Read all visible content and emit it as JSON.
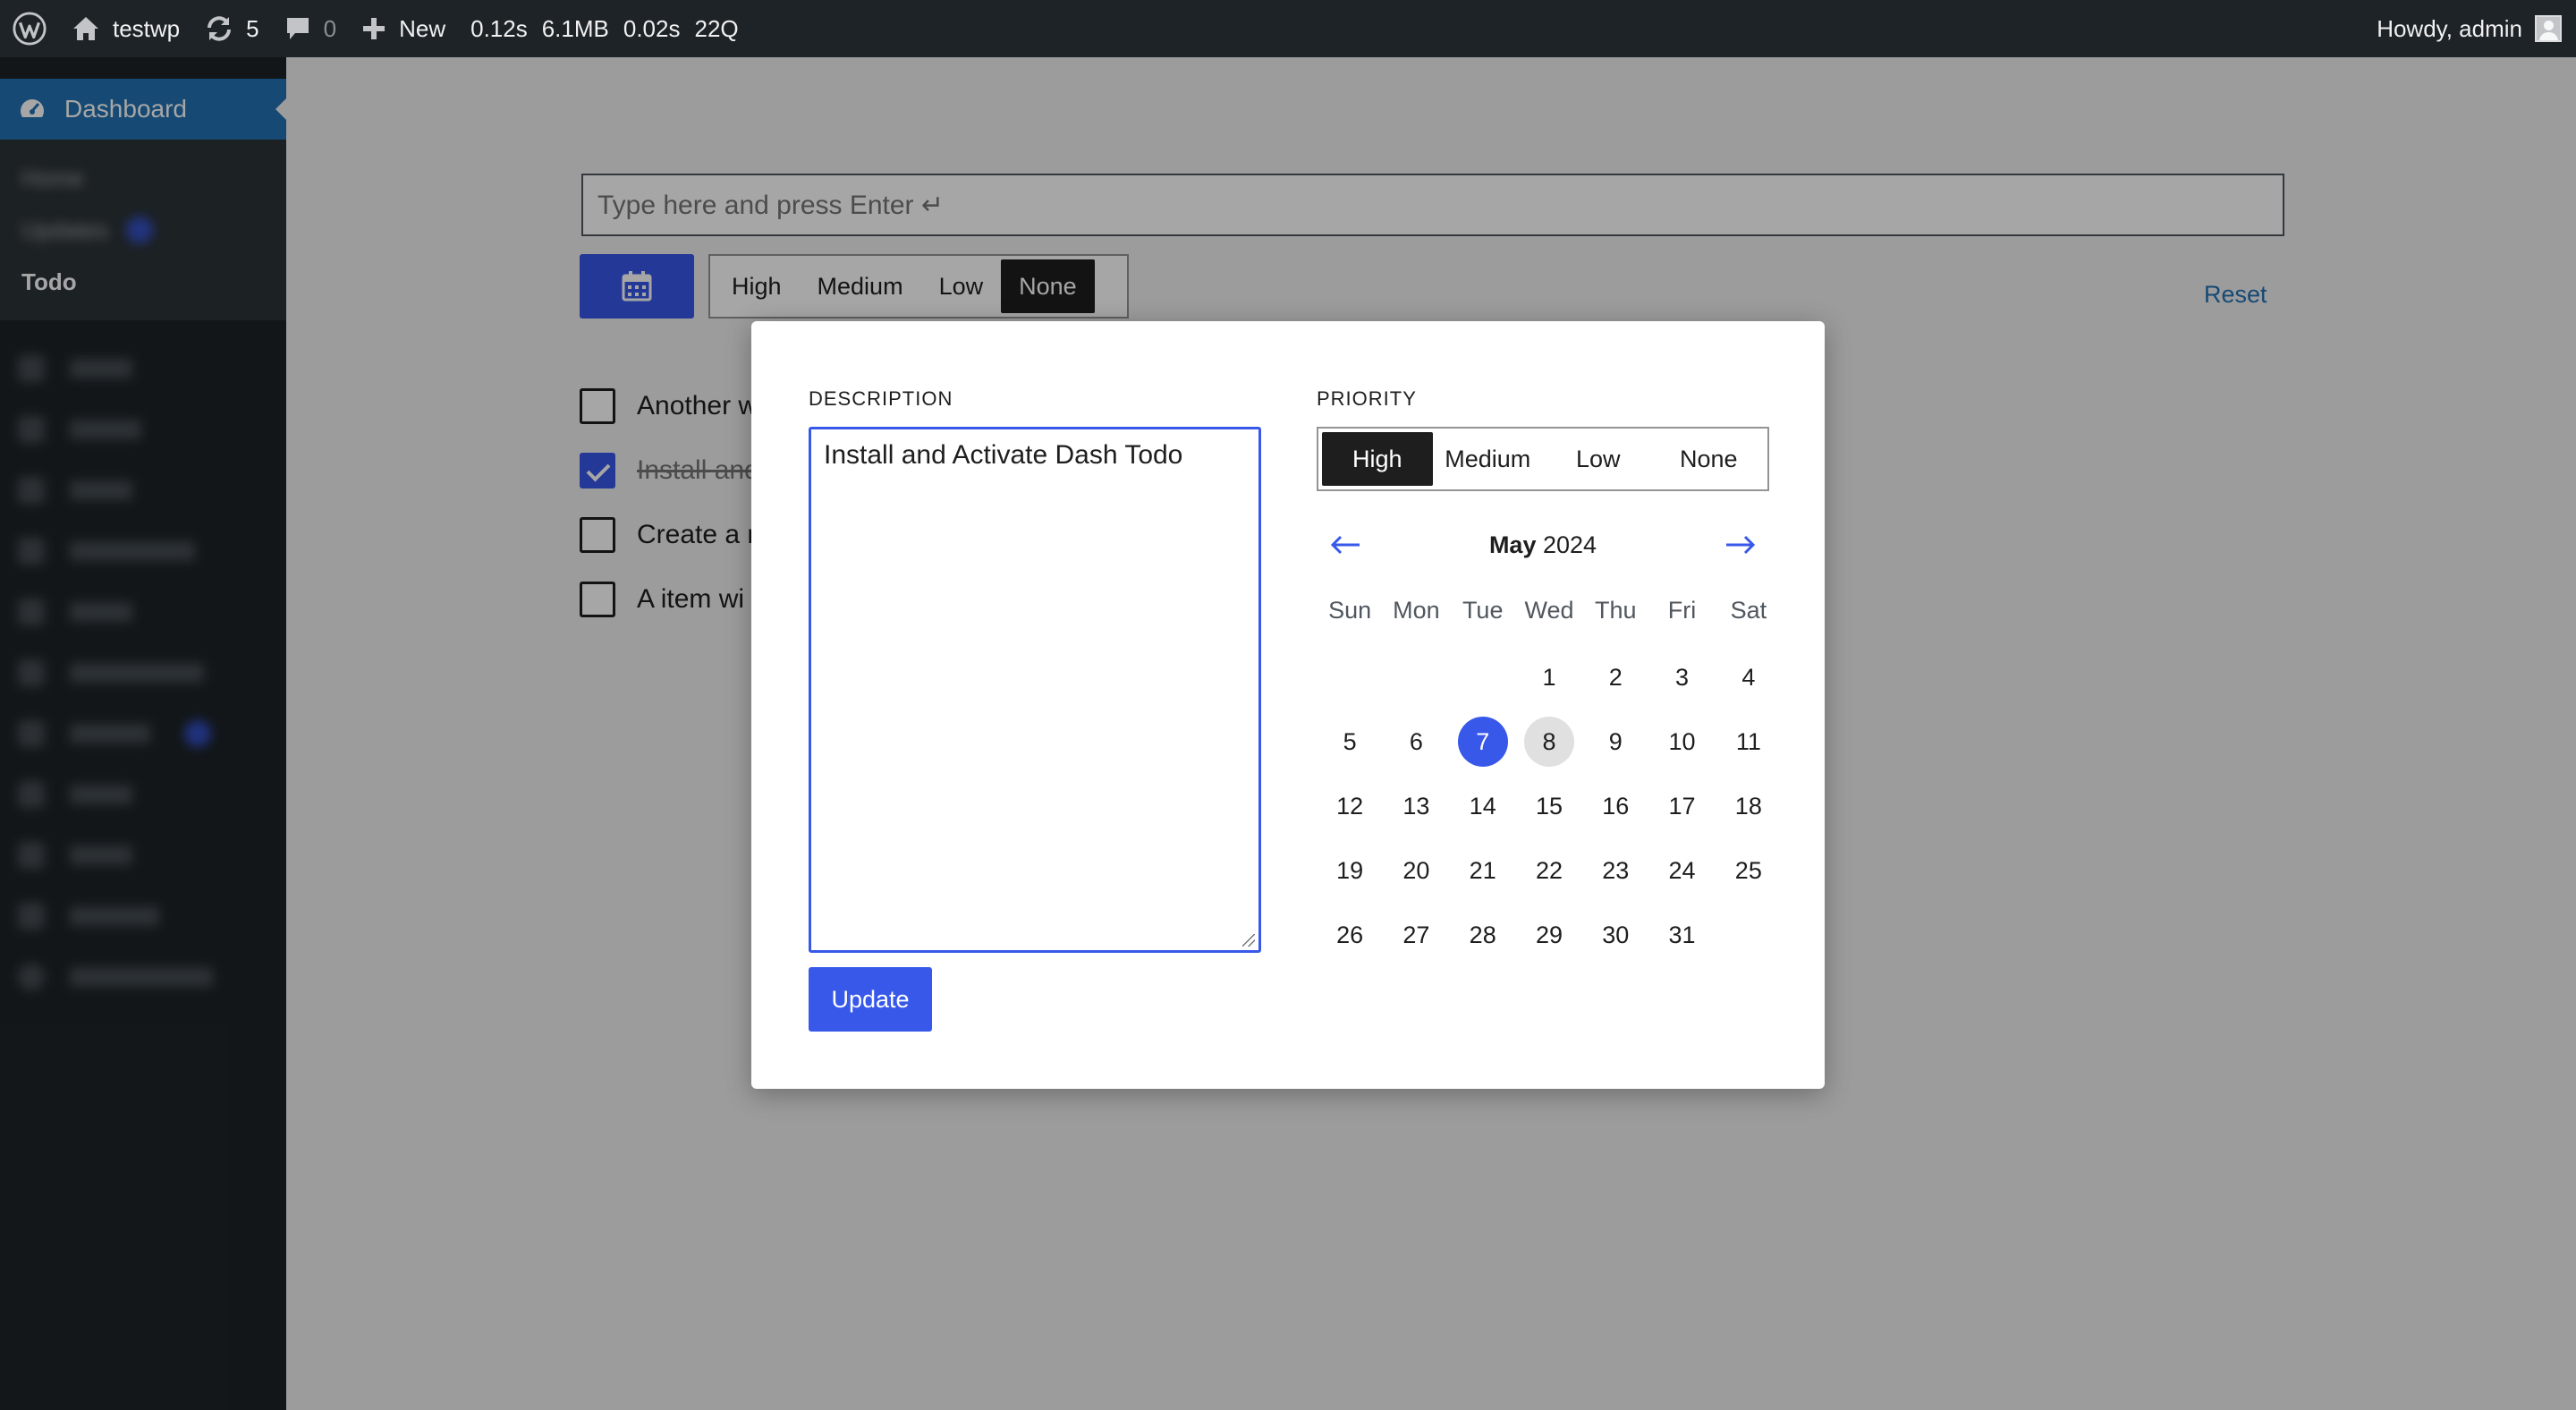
{
  "adminbar": {
    "site_name": "testwp",
    "updates_count": "5",
    "comments_count": "0",
    "new_label": "New",
    "perf": [
      "0.12s",
      "6.1MB",
      "0.02s",
      "22Q"
    ],
    "howdy": "Howdy, admin"
  },
  "sidebar": {
    "dashboard_label": "Dashboard",
    "submenu": [
      {
        "label": "Home",
        "blurred": true
      },
      {
        "label": "Updates",
        "blurred": true
      },
      {
        "label": "Todo",
        "blurred": false
      }
    ]
  },
  "todo": {
    "input_placeholder": "Type here and press Enter ↵",
    "priority_options": [
      "High",
      "Medium",
      "Low",
      "None"
    ],
    "selected_priority": "None",
    "reset_label": "Reset",
    "items": [
      {
        "text": "Another w",
        "done": false
      },
      {
        "text": "Install and",
        "done": true
      },
      {
        "text": "Create a r",
        "done": false
      },
      {
        "text": "A item wi",
        "done": false
      }
    ]
  },
  "modal": {
    "description_label": "DESCRIPTION",
    "description_value": "Install and Activate Dash Todo",
    "update_label": "Update",
    "priority_label": "PRIORITY",
    "priority_options": [
      "High",
      "Medium",
      "Low",
      "None"
    ],
    "selected_priority": "High",
    "calendar": {
      "month": "May",
      "year": "2024",
      "weekdays": [
        "Sun",
        "Mon",
        "Tue",
        "Wed",
        "Thu",
        "Fri",
        "Sat"
      ],
      "weeks": [
        [
          "",
          "",
          "",
          "1",
          "2",
          "3",
          "4"
        ],
        [
          "5",
          "6",
          "7",
          "8",
          "9",
          "10",
          "11"
        ],
        [
          "12",
          "13",
          "14",
          "15",
          "16",
          "17",
          "18"
        ],
        [
          "19",
          "20",
          "21",
          "22",
          "23",
          "24",
          "25"
        ],
        [
          "26",
          "27",
          "28",
          "29",
          "30",
          "31",
          ""
        ]
      ],
      "selected_day": "7",
      "hovered_day": "8"
    }
  },
  "colors": {
    "accent": "#3858e9",
    "adminbar_bg": "#1d2327",
    "wp_blue": "#2271b1"
  }
}
